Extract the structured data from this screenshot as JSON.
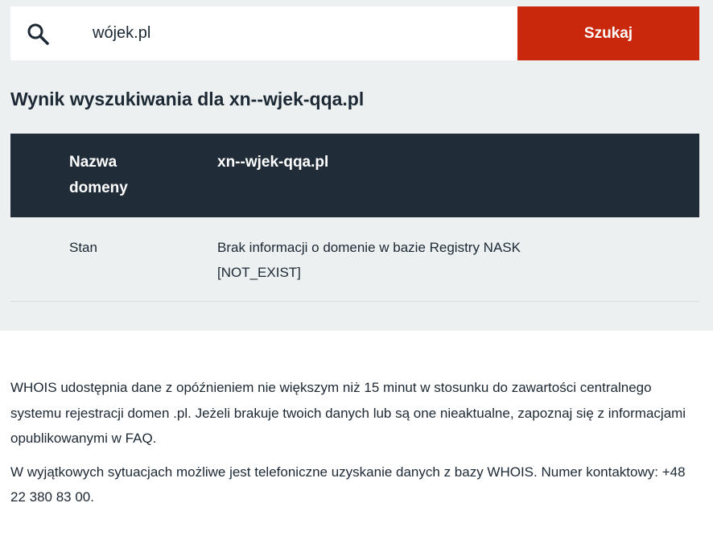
{
  "search": {
    "input_value": "wójek.pl",
    "button_label": "Szukaj"
  },
  "result": {
    "title": "Wynik wyszukiwania dla xn--wjek-qqa.pl",
    "header_key": "Nazwa domeny",
    "header_value": "xn--wjek-qqa.pl",
    "rows": [
      {
        "key": "Stan",
        "value": "Brak informacji o domenie w bazie Registry NASK [NOT_EXIST]"
      }
    ]
  },
  "info": {
    "paragraph1": "WHOIS udostępnia dane z opóźnieniem nie większym niż 15 minut w stosunku do zawartości centralnego systemu rejestracji domen .pl. Jeżeli brakuje twoich danych lub są one nieaktualne, zapoznaj się z informacjami opublikowanymi w FAQ.",
    "paragraph2": "W wyjątkowych sytuacjach możliwe jest telefoniczne uzyskanie danych z bazy WHOIS. Numer kontaktowy: +48 22 380 83 00."
  },
  "colors": {
    "accent": "#c9280d",
    "header_bg": "#202d39",
    "section_bg": "#ecf0f1"
  },
  "icons": {
    "search": "search-icon"
  }
}
